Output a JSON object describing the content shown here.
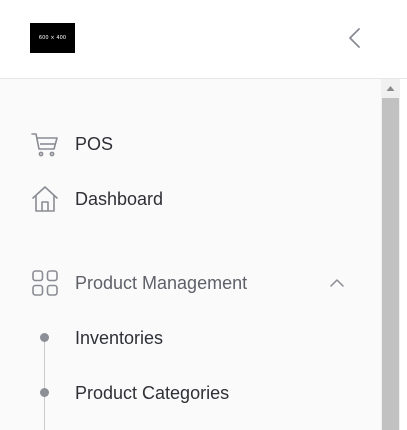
{
  "header": {
    "logo_text": "600 × 400",
    "collapse_icon": "chevron-left-icon"
  },
  "sidebar": {
    "items": [
      {
        "label": "POS",
        "icon": "shopping-cart-icon"
      },
      {
        "label": "Dashboard",
        "icon": "home-icon"
      },
      {
        "label": "Product Management",
        "icon": "grid-icon",
        "expanded": true,
        "children": [
          {
            "label": "Inventories"
          },
          {
            "label": "Product Categories"
          }
        ]
      }
    ]
  }
}
